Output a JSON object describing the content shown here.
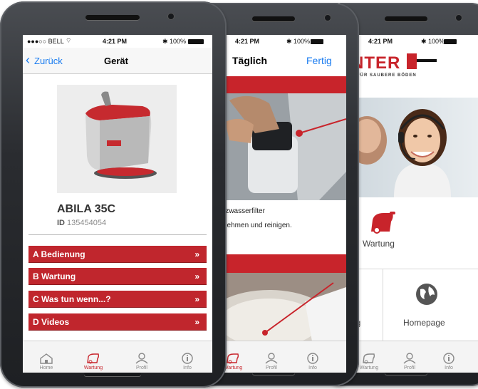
{
  "phone1": {
    "status": {
      "carrier": "●●●○○ BELL",
      "time": "4:21 PM",
      "battery": "100%"
    },
    "nav": {
      "back_label": "Zurück",
      "title": "Gerät"
    },
    "device": {
      "name": "ABILA 35C",
      "id_label": "ID",
      "id_value": "135454054"
    },
    "menu": [
      {
        "label": "A Bedienung",
        "chevron": "»"
      },
      {
        "label": "B Wartung",
        "chevron": "»"
      },
      {
        "label": "C Was tun wenn...?",
        "chevron": "»"
      },
      {
        "label": "D Videos",
        "chevron": "»"
      }
    ],
    "tabs": [
      {
        "label": "Home",
        "icon": "home-icon"
      },
      {
        "label": "Wartung",
        "icon": "machine-icon"
      },
      {
        "label": "Profil",
        "icon": "person-icon"
      },
      {
        "label": "Info",
        "icon": "info-icon"
      }
    ]
  },
  "phone2": {
    "status": {
      "time": "4:21 PM",
      "battery": "100%"
    },
    "nav": {
      "title": "Täglich",
      "done_label": "Fertig"
    },
    "text_line1": "utzwasserfilter",
    "text_line2": "snehmen und reinigen.",
    "tabs": [
      {
        "label": "Wartung",
        "icon": "machine-icon"
      },
      {
        "label": "Profil",
        "icon": "person-icon"
      },
      {
        "label": "Info",
        "icon": "info-icon"
      }
    ]
  },
  "phone3": {
    "status": {
      "time": "4:21 PM",
      "battery": "100%"
    },
    "logo_text": "NTER",
    "logo_sub": "K FÜR SAUBERE BÖDEN",
    "tiles": {
      "wartung": "Wartung",
      "partial": "ng",
      "homepage": "Homepage"
    },
    "tabs": [
      {
        "label": "Wartung",
        "icon": "machine-icon"
      },
      {
        "label": "Profil",
        "icon": "person-icon"
      },
      {
        "label": "Info",
        "icon": "info-icon"
      }
    ]
  },
  "colors": {
    "brand_red": "#c8242b",
    "ios_blue": "#1a7cf0"
  }
}
